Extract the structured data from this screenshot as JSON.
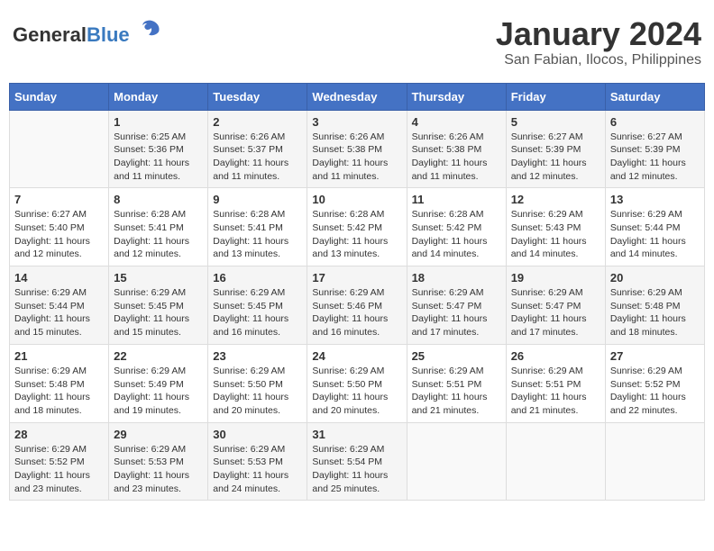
{
  "header": {
    "logo_general": "General",
    "logo_blue": "Blue",
    "month_title": "January 2024",
    "location": "San Fabian, Ilocos, Philippines"
  },
  "days_of_week": [
    "Sunday",
    "Monday",
    "Tuesday",
    "Wednesday",
    "Thursday",
    "Friday",
    "Saturday"
  ],
  "weeks": [
    [
      null,
      {
        "num": "1",
        "sunrise": "6:25 AM",
        "sunset": "5:36 PM",
        "daylight": "11 hours and 11 minutes."
      },
      {
        "num": "2",
        "sunrise": "6:26 AM",
        "sunset": "5:37 PM",
        "daylight": "11 hours and 11 minutes."
      },
      {
        "num": "3",
        "sunrise": "6:26 AM",
        "sunset": "5:38 PM",
        "daylight": "11 hours and 11 minutes."
      },
      {
        "num": "4",
        "sunrise": "6:26 AM",
        "sunset": "5:38 PM",
        "daylight": "11 hours and 11 minutes."
      },
      {
        "num": "5",
        "sunrise": "6:27 AM",
        "sunset": "5:39 PM",
        "daylight": "11 hours and 12 minutes."
      },
      {
        "num": "6",
        "sunrise": "6:27 AM",
        "sunset": "5:39 PM",
        "daylight": "11 hours and 12 minutes."
      }
    ],
    [
      {
        "num": "7",
        "sunrise": "6:27 AM",
        "sunset": "5:40 PM",
        "daylight": "11 hours and 12 minutes."
      },
      {
        "num": "8",
        "sunrise": "6:28 AM",
        "sunset": "5:41 PM",
        "daylight": "11 hours and 12 minutes."
      },
      {
        "num": "9",
        "sunrise": "6:28 AM",
        "sunset": "5:41 PM",
        "daylight": "11 hours and 13 minutes."
      },
      {
        "num": "10",
        "sunrise": "6:28 AM",
        "sunset": "5:42 PM",
        "daylight": "11 hours and 13 minutes."
      },
      {
        "num": "11",
        "sunrise": "6:28 AM",
        "sunset": "5:42 PM",
        "daylight": "11 hours and 14 minutes."
      },
      {
        "num": "12",
        "sunrise": "6:29 AM",
        "sunset": "5:43 PM",
        "daylight": "11 hours and 14 minutes."
      },
      {
        "num": "13",
        "sunrise": "6:29 AM",
        "sunset": "5:44 PM",
        "daylight": "11 hours and 14 minutes."
      }
    ],
    [
      {
        "num": "14",
        "sunrise": "6:29 AM",
        "sunset": "5:44 PM",
        "daylight": "11 hours and 15 minutes."
      },
      {
        "num": "15",
        "sunrise": "6:29 AM",
        "sunset": "5:45 PM",
        "daylight": "11 hours and 15 minutes."
      },
      {
        "num": "16",
        "sunrise": "6:29 AM",
        "sunset": "5:45 PM",
        "daylight": "11 hours and 16 minutes."
      },
      {
        "num": "17",
        "sunrise": "6:29 AM",
        "sunset": "5:46 PM",
        "daylight": "11 hours and 16 minutes."
      },
      {
        "num": "18",
        "sunrise": "6:29 AM",
        "sunset": "5:47 PM",
        "daylight": "11 hours and 17 minutes."
      },
      {
        "num": "19",
        "sunrise": "6:29 AM",
        "sunset": "5:47 PM",
        "daylight": "11 hours and 17 minutes."
      },
      {
        "num": "20",
        "sunrise": "6:29 AM",
        "sunset": "5:48 PM",
        "daylight": "11 hours and 18 minutes."
      }
    ],
    [
      {
        "num": "21",
        "sunrise": "6:29 AM",
        "sunset": "5:48 PM",
        "daylight": "11 hours and 18 minutes."
      },
      {
        "num": "22",
        "sunrise": "6:29 AM",
        "sunset": "5:49 PM",
        "daylight": "11 hours and 19 minutes."
      },
      {
        "num": "23",
        "sunrise": "6:29 AM",
        "sunset": "5:50 PM",
        "daylight": "11 hours and 20 minutes."
      },
      {
        "num": "24",
        "sunrise": "6:29 AM",
        "sunset": "5:50 PM",
        "daylight": "11 hours and 20 minutes."
      },
      {
        "num": "25",
        "sunrise": "6:29 AM",
        "sunset": "5:51 PM",
        "daylight": "11 hours and 21 minutes."
      },
      {
        "num": "26",
        "sunrise": "6:29 AM",
        "sunset": "5:51 PM",
        "daylight": "11 hours and 21 minutes."
      },
      {
        "num": "27",
        "sunrise": "6:29 AM",
        "sunset": "5:52 PM",
        "daylight": "11 hours and 22 minutes."
      }
    ],
    [
      {
        "num": "28",
        "sunrise": "6:29 AM",
        "sunset": "5:52 PM",
        "daylight": "11 hours and 23 minutes."
      },
      {
        "num": "29",
        "sunrise": "6:29 AM",
        "sunset": "5:53 PM",
        "daylight": "11 hours and 23 minutes."
      },
      {
        "num": "30",
        "sunrise": "6:29 AM",
        "sunset": "5:53 PM",
        "daylight": "11 hours and 24 minutes."
      },
      {
        "num": "31",
        "sunrise": "6:29 AM",
        "sunset": "5:54 PM",
        "daylight": "11 hours and 25 minutes."
      },
      null,
      null,
      null
    ]
  ]
}
